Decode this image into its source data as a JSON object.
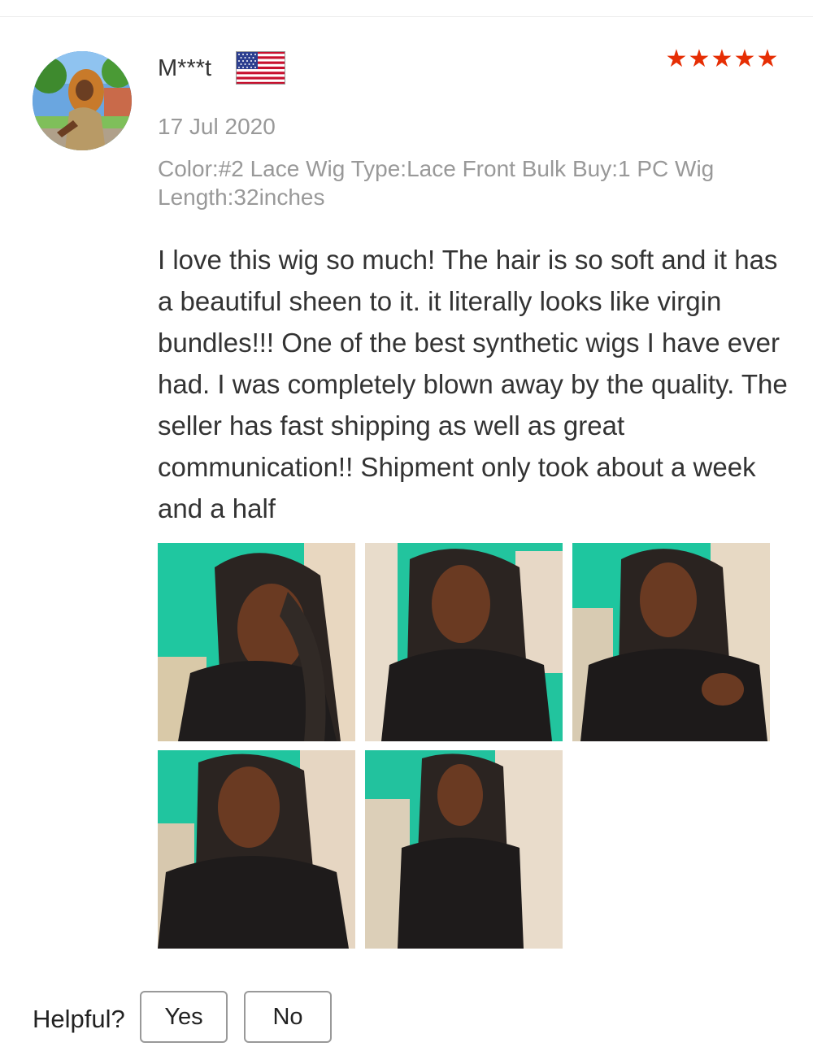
{
  "reviewer": {
    "name": "M***t",
    "country_flag_icon": "us-flag-icon",
    "avatar_icon": "user-avatar-photo"
  },
  "rating": {
    "stars": 5,
    "max": 5,
    "color": "#e62e04"
  },
  "review": {
    "date": "17 Jul 2020",
    "sku_info": "Color:#2 Lace Wig Type:Lace Front Bulk Buy:1 PC Wig Length:32inches",
    "text": "I love this wig so much! The hair is so soft and it has a beautiful sheen to it. it literally looks like virgin bundles!!! One of the best synthetic wigs I have ever had. I was completely blown away by the quality. The seller has fast shipping as well as great communication!! Shipment only took about a week and a half"
  },
  "photos": {
    "count": 5
  },
  "feedback": {
    "label": "Helpful?",
    "yes_label": "Yes",
    "no_label": "No"
  },
  "colors": {
    "text": "#333333",
    "muted": "#999999",
    "star": "#e62e04"
  }
}
